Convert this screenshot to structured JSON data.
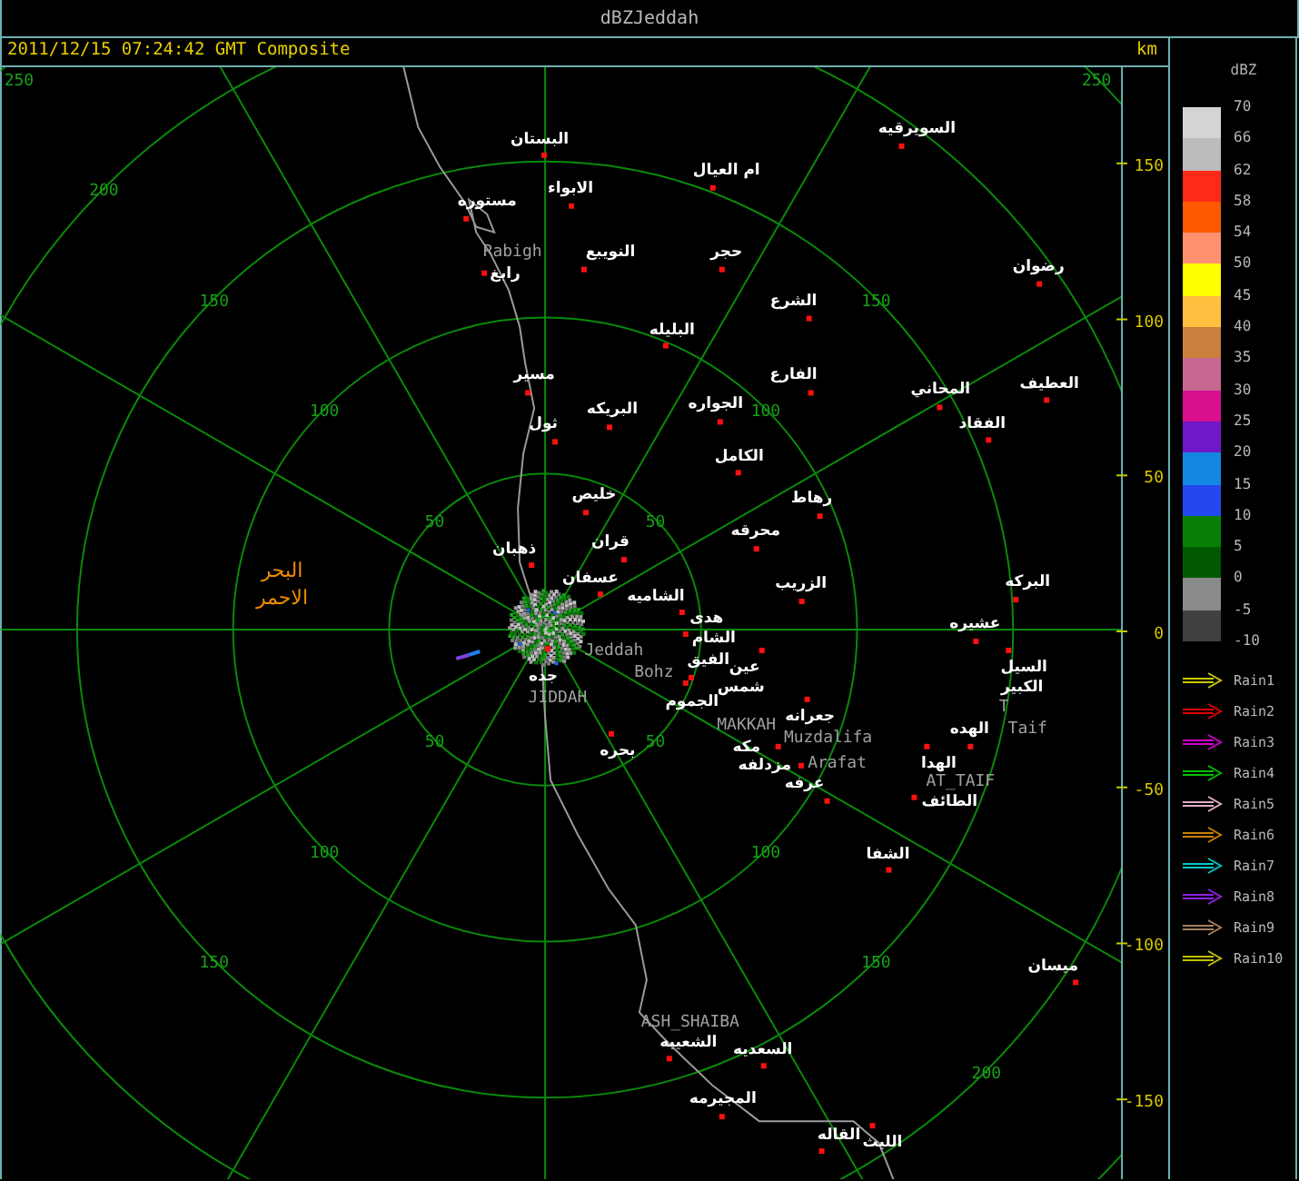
{
  "window": {
    "title": "dBZJeddah"
  },
  "info": {
    "timestamp": "2011/12/15 07:24:42 GMT Composite",
    "unit": "km"
  },
  "map": {
    "range_labels": [
      "250",
      "250",
      "200",
      "150",
      "150",
      "100",
      "100",
      "50",
      "50",
      "50",
      "50",
      "100",
      "100",
      "150",
      "150",
      "200"
    ],
    "axis_labels": [
      "150",
      "100",
      "50",
      "0",
      "-50",
      "-100",
      "-150"
    ],
    "places": [
      {
        "text": "السويرقيه",
        "kind": "town"
      },
      {
        "text": "البستان",
        "kind": "town"
      },
      {
        "text": "ام العيال",
        "kind": "town"
      },
      {
        "text": "الابواء",
        "kind": "town"
      },
      {
        "text": "مستوره",
        "kind": "town"
      },
      {
        "text": "حجر",
        "kind": "town"
      },
      {
        "text": "النويبع",
        "kind": "town"
      },
      {
        "text": "Rabigh",
        "kind": "latin"
      },
      {
        "text": "رضوان",
        "kind": "town"
      },
      {
        "text": "رابغ",
        "kind": "town"
      },
      {
        "text": "الشرع",
        "kind": "town"
      },
      {
        "text": "البليله",
        "kind": "town"
      },
      {
        "text": "العطيف",
        "kind": "town"
      },
      {
        "text": "المحاني",
        "kind": "town"
      },
      {
        "text": "الفارع",
        "kind": "town"
      },
      {
        "text": "مسير",
        "kind": "town"
      },
      {
        "text": "الجواره",
        "kind": "town"
      },
      {
        "text": "البريكه",
        "kind": "town"
      },
      {
        "text": "الفقاد",
        "kind": "town"
      },
      {
        "text": "ثول",
        "kind": "town"
      },
      {
        "text": "الكامل",
        "kind": "town"
      },
      {
        "text": "رهاط",
        "kind": "town"
      },
      {
        "text": "خليص",
        "kind": "town"
      },
      {
        "text": "محرقه",
        "kind": "town"
      },
      {
        "text": "قران",
        "kind": "town"
      },
      {
        "text": "ذهبان",
        "kind": "town"
      },
      {
        "text": "البحر",
        "kind": "sea"
      },
      {
        "text": "البركه",
        "kind": "town"
      },
      {
        "text": "الزريب",
        "kind": "town"
      },
      {
        "text": "عسفان",
        "kind": "town"
      },
      {
        "text": "الشاميه",
        "kind": "town"
      },
      {
        "text": "الاحمر",
        "kind": "sea"
      },
      {
        "text": "عشيره",
        "kind": "town"
      },
      {
        "text": "هدى",
        "kind": "town"
      },
      {
        "text": "الشام",
        "kind": "name"
      },
      {
        "text": "Jeddah",
        "kind": "latin"
      },
      {
        "text": "السيل",
        "kind": "town"
      },
      {
        "text": "عين",
        "kind": "town"
      },
      {
        "text": "الفيق",
        "kind": "town"
      },
      {
        "text": "Bohz",
        "kind": "latin"
      },
      {
        "text": "جده",
        "kind": "town"
      },
      {
        "text": "الكبير",
        "kind": "name"
      },
      {
        "text": "شمس",
        "kind": "name"
      },
      {
        "text": "JIDDAH",
        "kind": "latin"
      },
      {
        "text": "T",
        "kind": "latin"
      },
      {
        "text": "الجموم",
        "kind": "town"
      },
      {
        "text": "جعرانه",
        "kind": "town"
      },
      {
        "text": "Taif",
        "kind": "latin"
      },
      {
        "text": "الهده",
        "kind": "town"
      },
      {
        "text": "MAKKAH",
        "kind": "latin"
      },
      {
        "text": "Muzdalifa",
        "kind": "latin"
      },
      {
        "text": "مكه",
        "kind": "town"
      },
      {
        "text": "بحره",
        "kind": "town"
      },
      {
        "text": "الهدا",
        "kind": "town"
      },
      {
        "text": "Arafat",
        "kind": "latin"
      },
      {
        "text": "مزدلفه",
        "kind": "town"
      },
      {
        "text": "AT_TAIF",
        "kind": "latin"
      },
      {
        "text": "عرفه",
        "kind": "town"
      },
      {
        "text": "الطائف",
        "kind": "town"
      },
      {
        "text": "الشفا",
        "kind": "town"
      },
      {
        "text": "ميسان",
        "kind": "town"
      },
      {
        "text": "ASH_SHAIBA",
        "kind": "latin"
      },
      {
        "text": "السعديه",
        "kind": "town"
      },
      {
        "text": "الشعيبه",
        "kind": "town"
      },
      {
        "text": "المجيرمه",
        "kind": "town"
      },
      {
        "text": "الليث",
        "kind": "town"
      },
      {
        "text": "القاله",
        "kind": "town"
      }
    ]
  },
  "legend": {
    "title": "dBZ",
    "levels": [
      "70",
      "66",
      "62",
      "58",
      "54",
      "50",
      "45",
      "40",
      "35",
      "30",
      "25",
      "20",
      "15",
      "10",
      "5",
      "0",
      "-5",
      "-10"
    ],
    "bins": [
      {
        "color": "#d4d4d4"
      },
      {
        "color": "#bcbcbc"
      },
      {
        "color": "#ff2a1a"
      },
      {
        "color": "#ff5a00"
      },
      {
        "color": "#ff9070"
      },
      {
        "color": "#ffff00"
      },
      {
        "color": "#ffc040"
      },
      {
        "color": "#c8803c"
      },
      {
        "color": "#c86890"
      },
      {
        "color": "#d81090"
      },
      {
        "color": "#7018c8"
      },
      {
        "color": "#1488e0"
      },
      {
        "color": "#2448f0"
      },
      {
        "color": "#088008"
      },
      {
        "color": "#005800"
      },
      {
        "color": "#8a8a8a"
      },
      {
        "color": "#404040"
      }
    ]
  },
  "rain_legend": [
    {
      "label": "Rain1",
      "color": "#c8c800"
    },
    {
      "label": "Rain2",
      "color": "#e00000"
    },
    {
      "label": "Rain3",
      "color": "#d000d0"
    },
    {
      "label": "Rain4",
      "color": "#00c000"
    },
    {
      "label": "Rain5",
      "color": "#e0b0c8"
    },
    {
      "label": "Rain6",
      "color": "#c88000"
    },
    {
      "label": "Rain7",
      "color": "#00c8c8"
    },
    {
      "label": "Rain8",
      "color": "#9020e0"
    },
    {
      "label": "Rain9",
      "color": "#a08060"
    },
    {
      "label": "Rain10",
      "color": "#c0c000"
    }
  ]
}
